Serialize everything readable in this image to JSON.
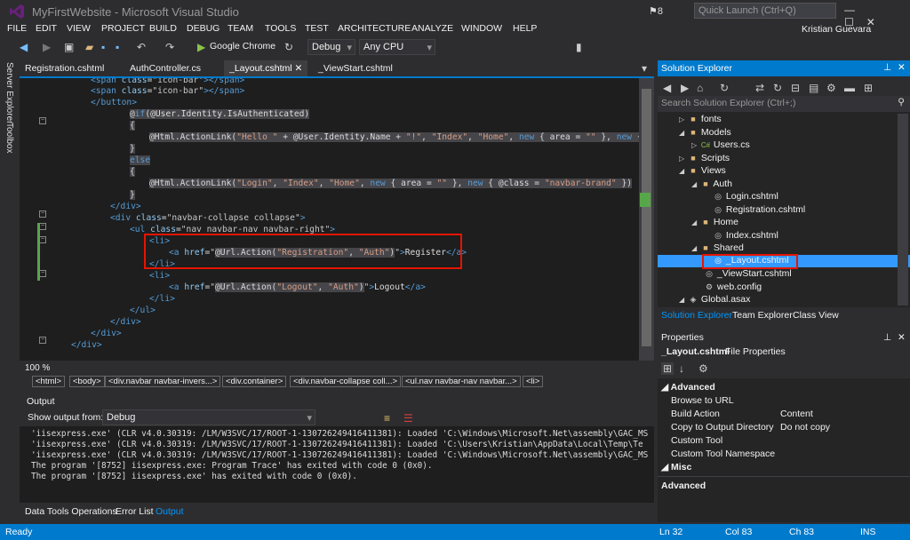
{
  "window": {
    "title": "MyFirstWebsite - Microsoft Visual Studio",
    "notifications": "8",
    "quick_launch_placeholder": "Quick Launch (Ctrl+Q)"
  },
  "menu": [
    "FILE",
    "EDIT",
    "VIEW",
    "PROJECT",
    "BUILD",
    "DEBUG",
    "TEAM",
    "TOOLS",
    "TEST",
    "ARCHITECTURE",
    "ANALYZE",
    "WINDOW",
    "HELP"
  ],
  "user": "Kristian Guevara",
  "toolbar": {
    "browser": "Google Chrome",
    "config": "Debug",
    "platform": "Any CPU"
  },
  "left_sidebar": [
    "Server Explorer",
    "Toolbox"
  ],
  "tabs": [
    "Registration.cshtml",
    "AuthController.cs",
    "_Layout.cshtml",
    "_ViewStart.cshtml"
  ],
  "code_lines": [
    "            <span class=\"icon-bar\"></span>",
    "            <span class=\"icon-bar\"></span>",
    "        </button>",
    "        @if(@User.Identity.IsAuthenticated)",
    "        {",
    "            @Html.ActionLink(\"Hello \" + @User.Identity.Name + \"!\", \"Index\", \"Home\", new { area = \"\" }, new { @c",
    "        }",
    "        else",
    "        {",
    "            @Html.ActionLink(\"Login\", \"Index\", \"Home\", new { area = \"\" }, new { @class = \"navbar-brand\" })",
    "        }",
    "    </div>",
    "    <div class=\"navbar-collapse collapse\">",
    "        <ul class=\"nav navbar-nav navbar-right\">",
    "            <li>",
    "                <a href=\"@Url.Action(\"Registration\", \"Auth\")\">Register</a>",
    "            </li>",
    "            <li>",
    "                <a href=\"@Url.Action(\"Logout\", \"Auth\")\">Logout</a>",
    "            </li>",
    "        </ul>",
    "    </div>",
    "  </div>",
    "</div>"
  ],
  "zoom": "100 %",
  "breadcrumb": [
    "<html>",
    "<body>",
    "<div.navbar navbar-invers...>",
    "<div.container>",
    "<div.navbar-collapse coll...>",
    "<ul.nav navbar-nav navbar...>",
    "<li>"
  ],
  "output": {
    "title": "Output",
    "show_from_label": "Show output from:",
    "source": "Debug",
    "lines": [
      "'iisexpress.exe' (CLR v4.0.30319: /LM/W3SVC/17/ROOT-1-130726249416411381): Loaded 'C:\\Windows\\Microsoft.Net\\assembly\\GAC_MS",
      "'iisexpress.exe' (CLR v4.0.30319: /LM/W3SVC/17/ROOT-1-130726249416411381): Loaded 'C:\\Users\\Kristian\\AppData\\Local\\Temp\\Te",
      "'iisexpress.exe' (CLR v4.0.30319: /LM/W3SVC/17/ROOT-1-130726249416411381): Loaded 'C:\\Windows\\Microsoft.Net\\assembly\\GAC_MS",
      "The program '[8752] iisexpress.exe: Program Trace' has exited with code 0 (0x0).",
      "The program '[8752] iisexpress.exe' has exited with code 0 (0x0)."
    ]
  },
  "bottom_tabs": [
    "Data Tools Operations",
    "Error List",
    "Output"
  ],
  "status": {
    "ready": "Ready",
    "ln": "Ln 32",
    "col": "Col 83",
    "ch": "Ch 83",
    "mode": "INS"
  },
  "solution_explorer": {
    "title": "Solution Explorer",
    "search_placeholder": "Search Solution Explorer (Ctrl+;)",
    "items": [
      "fonts",
      "Models",
      "Users.cs",
      "Scripts",
      "Views",
      "Auth",
      "Login.cshtml",
      "Registration.cshtml",
      "Home",
      "Index.cshtml",
      "Shared",
      "_Layout.cshtml",
      "_ViewStart.cshtml",
      "web.config",
      "Global.asax"
    ],
    "tabs": [
      "Solution Explorer",
      "Team Explorer",
      "Class View"
    ]
  },
  "properties": {
    "title": "Properties",
    "file": "_Layout.cshtml",
    "file_kind": "File Properties",
    "advanced": "Advanced",
    "rows": [
      {
        "name": "Browse to URL",
        "value": ""
      },
      {
        "name": "Build Action",
        "value": "Content"
      },
      {
        "name": "Copy to Output Directory",
        "value": "Do not copy"
      },
      {
        "name": "Custom Tool",
        "value": ""
      },
      {
        "name": "Custom Tool Namespace",
        "value": ""
      }
    ],
    "misc": "Misc",
    "description_title": "Advanced"
  }
}
